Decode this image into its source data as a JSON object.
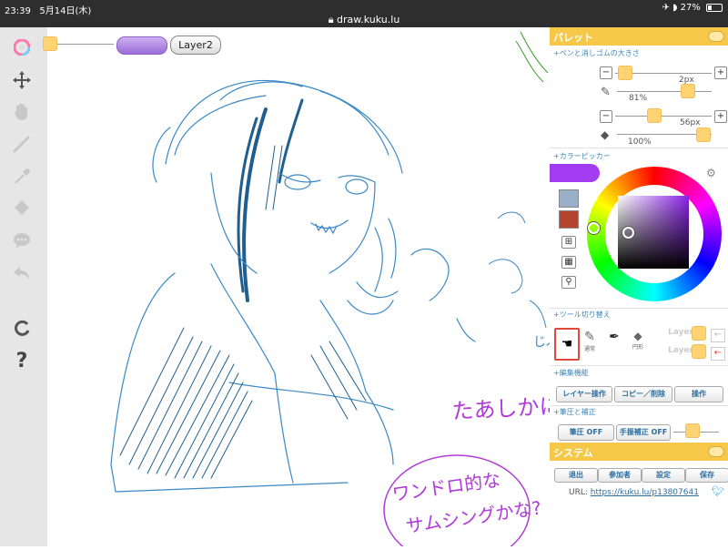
{
  "status": {
    "time": "23:39",
    "date": "5月14日(木)",
    "url": "draw.kuku.lu",
    "battery": "27%",
    "battery_level": 0.27
  },
  "toolbar": {
    "icons": [
      "color-wheel-icon",
      "move-icon",
      "hand-icon",
      "pen-icon",
      "eyedropper-icon",
      "eraser-icon",
      "chat-icon",
      "undo-icon",
      "redo-icon",
      "help-icon"
    ]
  },
  "topbar": {
    "layer_name": "Layer2"
  },
  "palette": {
    "title": "パレット",
    "pen_eraser_section": "+ペンと消しゴムの大きさ",
    "pen_size": "2px",
    "pen_opacity": "81%",
    "eraser_size": "56px",
    "eraser_opacity": "100%",
    "color_picker_section": "+カラーピッカー",
    "current_color": "#a23cf0",
    "swatches": [
      "#9ab0c8",
      "#b5442e"
    ],
    "tool_section": "+ツール切り替え",
    "tool_labels": {
      "normal": "通常",
      "circle": "円形"
    },
    "layer1": "Layer1",
    "layer2": "Layer2",
    "edit_section": "+編集機能",
    "edit_buttons": {
      "layer": "レイヤー操作",
      "copy": "コピー／削除",
      "ops": "操作"
    },
    "pressure_section": "+筆圧と補正",
    "pressure_buttons": {
      "pressure": "筆圧 OFF",
      "shake": "手振補正 OFF"
    }
  },
  "system": {
    "title": "システム",
    "buttons": {
      "exit": "退出",
      "members": "参加者",
      "settings": "設定",
      "save": "保存"
    },
    "url_label": "URL:",
    "url": "https://kuku.lu/p13807641"
  },
  "canvas_text": {
    "line1": "たあしかに",
    "line2": "ワンドロ的な",
    "line3": "サムシングかな?",
    "line4": "じぶ"
  }
}
